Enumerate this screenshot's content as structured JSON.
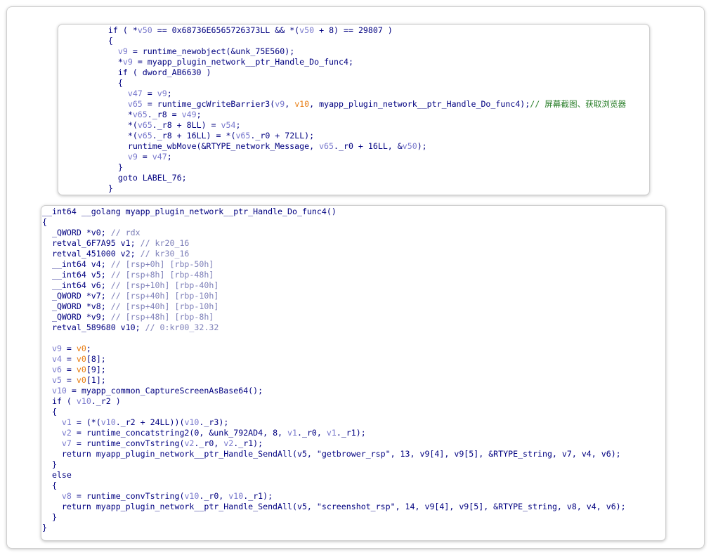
{
  "panel_top": {
    "lines": [
      [
        [
          "k",
          "    if ( "
        ],
        [
          "t",
          "*"
        ],
        [
          "v",
          "v50"
        ],
        [
          "t",
          " == 0x68736E6565726373LL && *("
        ],
        [
          "v",
          "v50"
        ],
        [
          "t",
          " + 8) == 29807 )"
        ]
      ],
      [
        [
          "t",
          "    {"
        ]
      ],
      [
        [
          "t",
          "      "
        ],
        [
          "v",
          "v9"
        ],
        [
          "t",
          " = runtime_newobject(&unk_75E560);"
        ]
      ],
      [
        [
          "t",
          "      *"
        ],
        [
          "v",
          "v9"
        ],
        [
          "t",
          " = myapp_plugin_network__ptr_Handle_Do_func4;"
        ]
      ],
      [
        [
          "t",
          "      if ( dword_AB6630 )"
        ]
      ],
      [
        [
          "t",
          "      {"
        ]
      ],
      [
        [
          "t",
          "        "
        ],
        [
          "v",
          "v47"
        ],
        [
          "t",
          " = "
        ],
        [
          "v",
          "v9"
        ],
        [
          "t",
          ";"
        ]
      ],
      [
        [
          "t",
          "        "
        ],
        [
          "v",
          "v65"
        ],
        [
          "t",
          " = runtime_gcWriteBarrier3("
        ],
        [
          "v",
          "v9"
        ],
        [
          "t",
          ", "
        ],
        [
          "o",
          "v10"
        ],
        [
          "t",
          ", myapp_plugin_network__ptr_Handle_Do_func4);"
        ],
        [
          "cmt",
          "// 屏幕截图、获取浏览器"
        ]
      ],
      [
        [
          "t",
          "        *"
        ],
        [
          "v",
          "v65"
        ],
        [
          "t",
          "._r8 = "
        ],
        [
          "v",
          "v49"
        ],
        [
          "t",
          ";"
        ]
      ],
      [
        [
          "t",
          "        *("
        ],
        [
          "v",
          "v65"
        ],
        [
          "t",
          "._r8 + 8LL) = "
        ],
        [
          "v",
          "v54"
        ],
        [
          "t",
          ";"
        ]
      ],
      [
        [
          "t",
          "        *("
        ],
        [
          "v",
          "v65"
        ],
        [
          "t",
          "._r8 + 16LL) = *("
        ],
        [
          "v",
          "v65"
        ],
        [
          "t",
          "._r0 + 72LL);"
        ]
      ],
      [
        [
          "t",
          "        runtime_wbMove(&RTYPE_network_Message, "
        ],
        [
          "v",
          "v65"
        ],
        [
          "t",
          "._r0 + 16LL, &"
        ],
        [
          "v",
          "v50"
        ],
        [
          "t",
          ");"
        ]
      ],
      [
        [
          "t",
          "        "
        ],
        [
          "v",
          "v9"
        ],
        [
          "t",
          " = "
        ],
        [
          "v",
          "v47"
        ],
        [
          "t",
          ";"
        ]
      ],
      [
        [
          "t",
          "      }"
        ]
      ],
      [
        [
          "t",
          "      goto LABEL_76;"
        ]
      ],
      [
        [
          "t",
          "    }"
        ]
      ]
    ]
  },
  "panel_bottom": {
    "lines": [
      [
        [
          "t",
          "__int64 __golang myapp_plugin_network__ptr_Handle_Do_func4()"
        ]
      ],
      [
        [
          "t",
          "{"
        ]
      ],
      [
        [
          "t",
          "  _QWORD *v0; "
        ],
        [
          "c",
          "// rdx"
        ]
      ],
      [
        [
          "t",
          "  retval_6F7A95 v1; "
        ],
        [
          "c",
          "// kr20_16"
        ]
      ],
      [
        [
          "t",
          "  retval_451000 v2; "
        ],
        [
          "c",
          "// kr30_16"
        ]
      ],
      [
        [
          "t",
          "  __int64 v4; "
        ],
        [
          "c",
          "// [rsp+0h] [rbp-50h]"
        ]
      ],
      [
        [
          "t",
          "  __int64 v5; "
        ],
        [
          "c",
          "// [rsp+8h] [rbp-48h]"
        ]
      ],
      [
        [
          "t",
          "  __int64 v6; "
        ],
        [
          "c",
          "// [rsp+10h] [rbp-40h]"
        ]
      ],
      [
        [
          "t",
          "  _QWORD *v7; "
        ],
        [
          "c",
          "// [rsp+40h] [rbp-10h]"
        ]
      ],
      [
        [
          "t",
          "  _QWORD *v8; "
        ],
        [
          "c",
          "// [rsp+40h] [rbp-10h]"
        ]
      ],
      [
        [
          "t",
          "  _QWORD *v9; "
        ],
        [
          "c",
          "// [rsp+48h] [rbp-8h]"
        ]
      ],
      [
        [
          "t",
          "  retval_589680 v10; "
        ],
        [
          "c",
          "// 0:kr00_32.32"
        ]
      ],
      [
        [
          "t",
          ""
        ]
      ],
      [
        [
          "t",
          "  "
        ],
        [
          "v",
          "v9"
        ],
        [
          "t",
          " = "
        ],
        [
          "o",
          "v0"
        ],
        [
          "t",
          ";"
        ]
      ],
      [
        [
          "t",
          "  "
        ],
        [
          "v",
          "v4"
        ],
        [
          "t",
          " = "
        ],
        [
          "o",
          "v0"
        ],
        [
          "t",
          "[8];"
        ]
      ],
      [
        [
          "t",
          "  "
        ],
        [
          "v",
          "v6"
        ],
        [
          "t",
          " = "
        ],
        [
          "o",
          "v0"
        ],
        [
          "t",
          "[9];"
        ]
      ],
      [
        [
          "t",
          "  "
        ],
        [
          "v",
          "v5"
        ],
        [
          "t",
          " = "
        ],
        [
          "o",
          "v0"
        ],
        [
          "t",
          "[1];"
        ]
      ],
      [
        [
          "t",
          "  "
        ],
        [
          "v",
          "v10"
        ],
        [
          "t",
          " = myapp_common_CaptureScreenAsBase64();"
        ]
      ],
      [
        [
          "t",
          "  if ( "
        ],
        [
          "v",
          "v10"
        ],
        [
          "t",
          "._r2 )"
        ]
      ],
      [
        [
          "t",
          "  {"
        ]
      ],
      [
        [
          "t",
          "    "
        ],
        [
          "v",
          "v1"
        ],
        [
          "t",
          " = (*("
        ],
        [
          "v",
          "v10"
        ],
        [
          "t",
          "._r2 + 24LL))("
        ],
        [
          "v",
          "v10"
        ],
        [
          "t",
          "._r3);"
        ]
      ],
      [
        [
          "t",
          "    "
        ],
        [
          "v",
          "v2"
        ],
        [
          "t",
          " = runtime_concatstring2(0, &unk_792AD4, 8, "
        ],
        [
          "v",
          "v1"
        ],
        [
          "t",
          "._r0, "
        ],
        [
          "v",
          "v1"
        ],
        [
          "t",
          "._r1);"
        ]
      ],
      [
        [
          "t",
          "    "
        ],
        [
          "v",
          "v7"
        ],
        [
          "t",
          " = runtime_convTstring("
        ],
        [
          "v",
          "v2"
        ],
        [
          "t",
          "._r0, "
        ],
        [
          "v",
          "v2"
        ],
        [
          "t",
          "._r1);"
        ]
      ],
      [
        [
          "t",
          "    return myapp_plugin_network__ptr_Handle_SendAll(v5, "
        ],
        [
          "t",
          "\"getbrower_rsp\""
        ],
        [
          "t",
          ", 13, v9[4], v9[5], &RTYPE_string, v7, v4, v6);"
        ]
      ],
      [
        [
          "t",
          "  }"
        ]
      ],
      [
        [
          "t",
          "  else"
        ]
      ],
      [
        [
          "t",
          "  {"
        ]
      ],
      [
        [
          "t",
          "    "
        ],
        [
          "v",
          "v8"
        ],
        [
          "t",
          " = runtime_convTstring("
        ],
        [
          "v",
          "v10"
        ],
        [
          "t",
          "._r0, "
        ],
        [
          "v",
          "v10"
        ],
        [
          "t",
          "._r1);"
        ]
      ],
      [
        [
          "t",
          "    return myapp_plugin_network__ptr_Handle_SendAll(v5, "
        ],
        [
          "t",
          "\"screenshot_rsp\""
        ],
        [
          "t",
          ", 14, v9[4], v9[5], &RTYPE_string, v8, v4, v6);"
        ]
      ],
      [
        [
          "t",
          "  }"
        ]
      ],
      [
        [
          "t",
          "}"
        ]
      ]
    ]
  },
  "colors": {
    "code": "#000080",
    "variable": "#7777cc",
    "register_var": "#e87c10",
    "comment": "#7d7fb8",
    "chinese_comment": "#2a7f2a"
  }
}
